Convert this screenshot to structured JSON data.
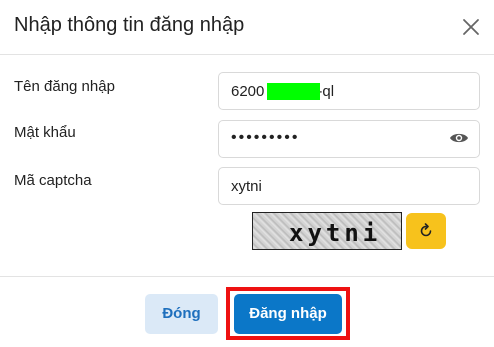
{
  "dialog": {
    "title": "Nhập thông tin đăng nhập"
  },
  "form": {
    "username": {
      "label": "Tên đăng nhập",
      "value": "6200",
      "value_suffix": "-ql"
    },
    "password": {
      "label": "Mật khẩu",
      "value": "•••••••••"
    },
    "captcha": {
      "label": "Mã captcha",
      "value": "xytni",
      "image_text": "xytni"
    }
  },
  "buttons": {
    "close": "Đóng",
    "login": "Đăng nhập"
  },
  "colors": {
    "primary": "#0b77c8",
    "secondary_bg": "#dbe9f7",
    "secondary_text": "#1e6fbd",
    "refresh": "#f7c21c",
    "highlight_border": "#ee1111",
    "redaction": "#00ff00"
  },
  "icons": {
    "close": "close-icon",
    "show_password": "eye-icon",
    "refresh_captcha": "refresh-icon"
  }
}
